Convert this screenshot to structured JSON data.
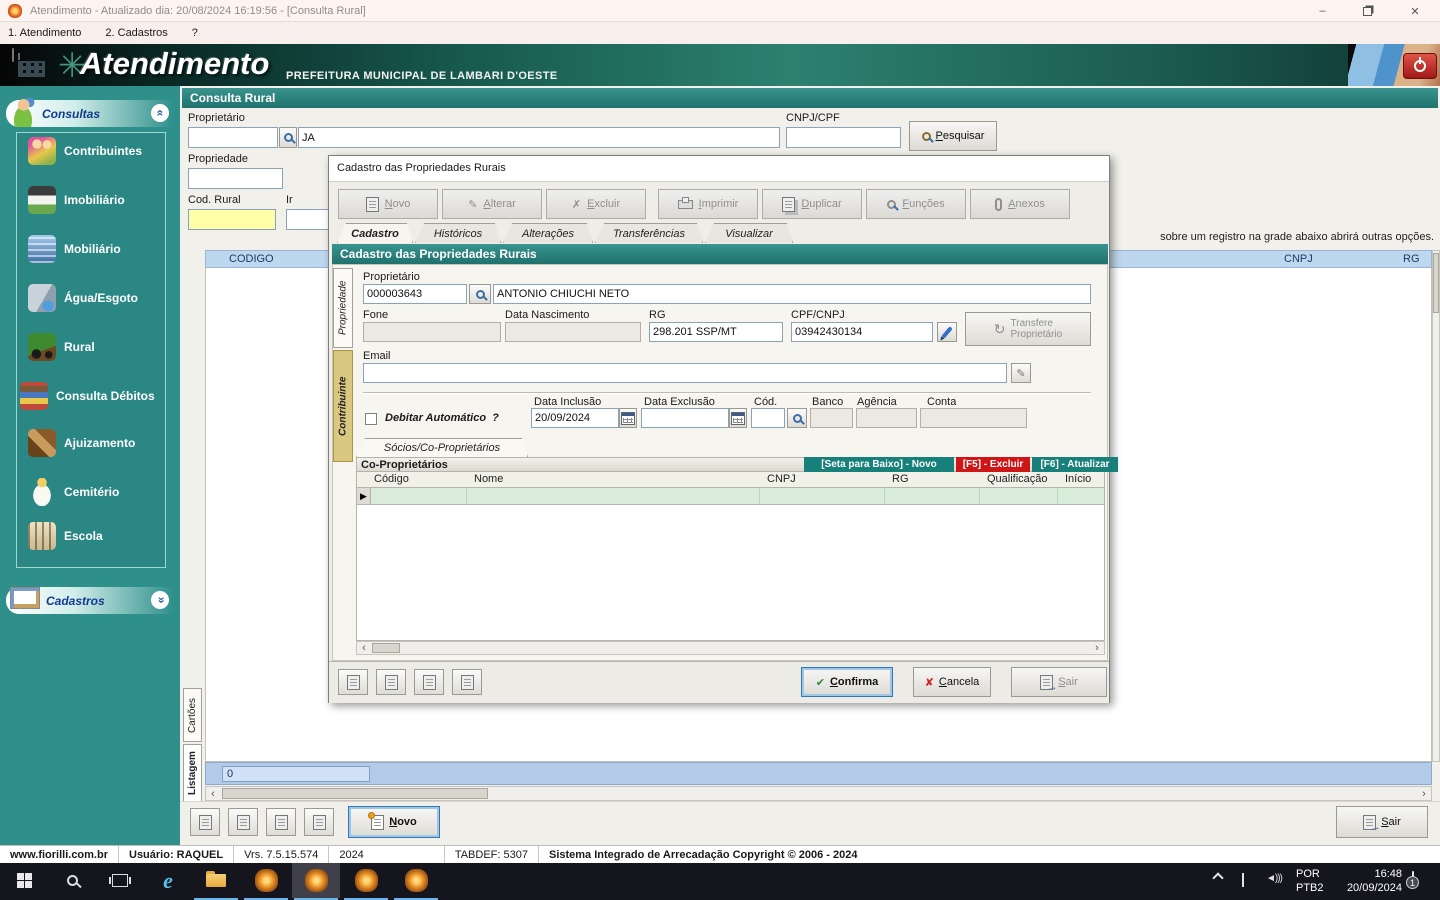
{
  "colors": {
    "teal": "#2e8f8b",
    "teal_dark": "#1f716d",
    "accent_blue": "#2b5fa8",
    "danger_red": "#cf1616",
    "selection_green": "#d9ecd9",
    "grid_header_blue": "#bdd7ee",
    "highlight_yellow": "#ffffa8"
  },
  "window": {
    "title": "Atendimento - Atualizado dia: 20/08/2024 16:19:56 - [Consulta Rural]"
  },
  "menubar": {
    "items": [
      {
        "label": "1. Atendimento"
      },
      {
        "label": "2. Cadastros"
      },
      {
        "label": "?"
      }
    ]
  },
  "banner": {
    "app_name": "Atendimento",
    "entity": "PREFEITURA MUNICIPAL DE LAMBARI D'OESTE"
  },
  "sidebar": {
    "groups": [
      {
        "label": "Consultas"
      },
      {
        "label": "Cadastros"
      }
    ],
    "items": [
      {
        "label": "Contribuintes",
        "icon": "people-icon"
      },
      {
        "label": "Imobiliário",
        "icon": "house-icon"
      },
      {
        "label": "Mobiliário",
        "icon": "building-icon"
      },
      {
        "label": "Água/Esgoto",
        "icon": "faucet-icon"
      },
      {
        "label": "Rural",
        "icon": "tractor-icon"
      },
      {
        "label": "Consulta Débitos",
        "icon": "books-icon"
      },
      {
        "label": "Ajuizamento",
        "icon": "gavel-icon"
      },
      {
        "label": "Cemitério",
        "icon": "angel-icon"
      },
      {
        "label": "Escola",
        "icon": "school-icon"
      }
    ]
  },
  "page": {
    "title": "Consulta Rural",
    "labels": {
      "proprietario": "Proprietário",
      "cnpj_cpf": "CNPJ/CPF",
      "propriedade": "Propriedade",
      "cod_rural": "Cod. Rural",
      "inscricao": "Ir"
    },
    "inputs": {
      "proprietario_cod": "",
      "proprietario_nome": "JA",
      "cnpj_cpf": "",
      "propriedade": "",
      "cod_rural": "",
      "inscricao": ""
    },
    "pesquisar": "Pesquisar",
    "hint": "sobre um registro na grade abaixo abrirá outras opções.",
    "grid": {
      "headers": [
        "CODIGO",
        "CNPJ",
        "RG"
      ]
    },
    "count": "0",
    "side_tabs": [
      {
        "label": "Cartões"
      },
      {
        "label": "Listagem"
      }
    ],
    "novo": "Novo",
    "sair": "Sair"
  },
  "dialog": {
    "title": "Cadastro das Propriedades Rurais",
    "toolbar": [
      {
        "label": "Novo"
      },
      {
        "label": "Alterar"
      },
      {
        "label": "Excluir"
      },
      {
        "label": "Imprimir"
      },
      {
        "label": "Duplicar"
      },
      {
        "label": "Funções"
      },
      {
        "label": "Anexos"
      }
    ],
    "tabs": [
      {
        "label": "Cadastro"
      },
      {
        "label": "Históricos"
      },
      {
        "label": "Alterações"
      },
      {
        "label": "Transferências"
      },
      {
        "label": "Visualizar"
      }
    ],
    "section_title": "Cadastro das Propriedades Rurais",
    "side_tabs": [
      {
        "label": "Propriedade"
      },
      {
        "label": "Contribuinte"
      }
    ],
    "form": {
      "proprietario_label": "Proprietário",
      "proprietario_cod": "000003643",
      "proprietario_nome": "ANTONIO CHIUCHI NETO",
      "fone_label": "Fone",
      "fone": "",
      "data_nascimento_label": "Data Nascimento",
      "data_nascimento": "",
      "rg_label": "RG",
      "rg": "298.201 SSP/MT",
      "cpf_cnpj_label": "CPF/CNPJ",
      "cpf_cnpj": "03942430134",
      "transfere_line1": "Transfere",
      "transfere_line2": "Proprietário",
      "email_label": "Email",
      "email": "",
      "debitar_label": "Debitar Automático",
      "debitar_q": "?",
      "data_inclusao_label": "Data Inclusão",
      "data_inclusao": "20/09/2024",
      "data_exclusao_label": "Data Exclusão",
      "data_exclusao": "",
      "cod_label": "Cód.",
      "cod": "",
      "banco_label": "Banco",
      "banco": "",
      "agencia_label": "Agência",
      "agencia": "",
      "conta_label": "Conta",
      "conta": ""
    },
    "socios": {
      "tab": "Sócios/Co-Proprietários",
      "header": "Co-Proprietários",
      "hotkeys": [
        {
          "label": "[Seta para Baixo] - Novo"
        },
        {
          "label": "[F5] - Excluir"
        },
        {
          "label": "[F6] - Atualizar"
        }
      ],
      "grid_headers": [
        "Código",
        "Nome",
        "CNPJ",
        "RG",
        "Qualificação",
        "Início"
      ]
    },
    "buttons": {
      "confirma": "Confirma",
      "cancela": "Cancela",
      "sair": "Sair"
    }
  },
  "statusbar": {
    "segments": [
      {
        "text": "www.fiorilli.com.br"
      },
      {
        "text": "Usuário: RAQUEL"
      },
      {
        "text": "Vrs. 7.5.15.574"
      },
      {
        "text": "2024"
      },
      {
        "text": "TABDEF: 5307"
      },
      {
        "text": "Sistema Integrado de Arrecadação Copyright © 2006 - 2024"
      }
    ]
  },
  "taskbar": {
    "lang_primary": "POR",
    "lang_secondary": "PTB2",
    "time": "16:48",
    "date": "20/09/2024",
    "notification_count": "1"
  }
}
